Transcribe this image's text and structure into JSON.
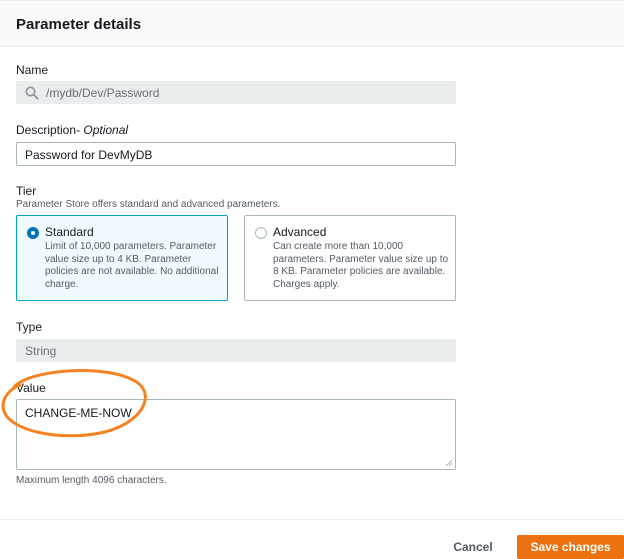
{
  "header": {
    "title": "Parameter details"
  },
  "name": {
    "label": "Name",
    "value": "/mydb/Dev/Password"
  },
  "description": {
    "label": "Description",
    "label_suffix": "- Optional",
    "value": "Password for DevMyDB"
  },
  "tier": {
    "label": "Tier",
    "description": "Parameter Store offers standard and advanced parameters.",
    "options": [
      {
        "title": "Standard",
        "body": "Limit of 10,000 parameters. Parameter value size up to 4 KB. Parameter policies are not available. No additional charge.",
        "selected": true
      },
      {
        "title": "Advanced",
        "body": "Can create more than 10,000 parameters. Parameter value size up to 8 KB. Parameter policies are available. Charges apply.",
        "selected": false
      }
    ]
  },
  "type": {
    "label": "Type",
    "value": "String"
  },
  "value": {
    "label": "Value",
    "text": "CHANGE-ME-NOW",
    "hint": "Maximum length 4096 characters."
  },
  "footer": {
    "cancel_label": "Cancel",
    "save_label": "Save changes"
  },
  "colors": {
    "primary": "#ec7211",
    "selected_border": "#00a1c9",
    "radio": "#0073bb",
    "annotation": "#f58220"
  }
}
